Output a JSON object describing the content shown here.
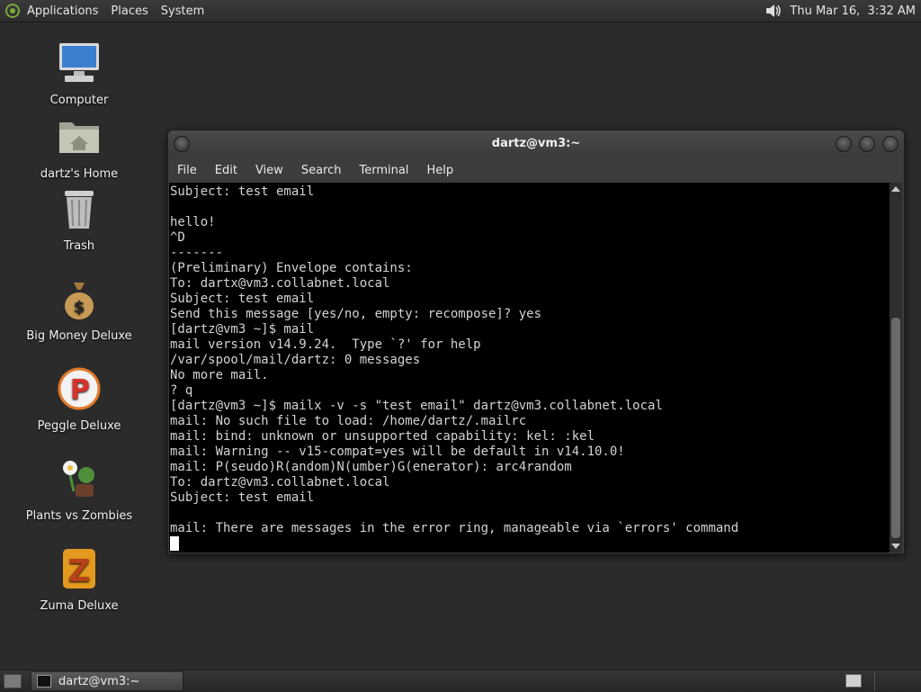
{
  "top_panel": {
    "menus": [
      "Applications",
      "Places",
      "System"
    ],
    "clock": "Thu Mar 16,  3:32 AM"
  },
  "desktop_icons": [
    {
      "label": "Computer",
      "icon": "computer-icon"
    },
    {
      "label": "dartz's Home",
      "icon": "home-folder-icon"
    },
    {
      "label": "Trash",
      "icon": "trash-icon"
    },
    {
      "label": "Big Money Deluxe",
      "icon": "money-bag-icon"
    },
    {
      "label": "Peggle Deluxe",
      "icon": "peggle-icon"
    },
    {
      "label": "Plants vs Zombies",
      "icon": "plants-vs-zombies-icon"
    },
    {
      "label": "Zuma Deluxe",
      "icon": "zuma-icon"
    }
  ],
  "terminal_window": {
    "title": "dartz@vm3:~",
    "menu": [
      "File",
      "Edit",
      "View",
      "Search",
      "Terminal",
      "Help"
    ],
    "lines": [
      "Subject: test email",
      "",
      "hello!",
      "^D",
      "-------",
      "(Preliminary) Envelope contains:",
      "To: dartx@vm3.collabnet.local",
      "Subject: test email",
      "Send this message [yes/no, empty: recompose]? yes",
      "[dartz@vm3 ~]$ mail",
      "mail version v14.9.24.  Type `?' for help",
      "/var/spool/mail/dartz: 0 messages",
      "No more mail.",
      "? q",
      "[dartz@vm3 ~]$ mailx -v -s \"test email\" dartz@vm3.collabnet.local",
      "mail: No such file to load: /home/dartz/.mailrc",
      "mail: bind: unknown or unsupported capability: kel: :kel",
      "mail: Warning -- v15-compat=yes will be default in v14.10.0!",
      "mail: P(seudo)R(andom)N(umber)G(enerator): arc4random",
      "To: dartz@vm3.collabnet.local",
      "Subject: test email",
      "",
      "mail: There are messages in the error ring, manageable via `errors' command"
    ]
  },
  "bottom_panel": {
    "task_label": "dartz@vm3:~"
  }
}
